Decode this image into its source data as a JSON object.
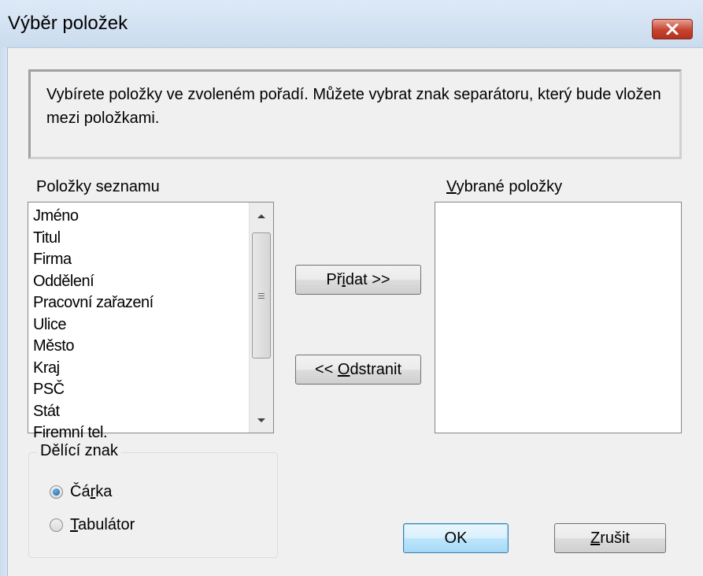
{
  "window": {
    "title": "Výběr položek"
  },
  "info": {
    "text": "Vybírete položky ve zvoleném pořadí. Můžete vybrat znak separátoru, který bude vložen mezi položkami."
  },
  "list": {
    "label": "Položky seznamu",
    "items": [
      "Jméno",
      "Titul",
      "Firma",
      "Oddělení",
      "Pracovní zařazení",
      "Ulice",
      "Město",
      "Kraj",
      "PSČ",
      "Stát",
      "Firemní tel."
    ]
  },
  "selected": {
    "label_first": "V",
    "label_rest": "ybrané položky",
    "items": []
  },
  "buttons": {
    "add_pre": "Př",
    "add_accel": "i",
    "add_post": "dat >>",
    "remove_pre": "<< ",
    "remove_accel": "O",
    "remove_post": "dstranit",
    "ok": "OK",
    "cancel_accel": "Z",
    "cancel_post": "rušit"
  },
  "separator": {
    "legend": "Dělící znak",
    "comma_pre": "Čá",
    "comma_accel": "r",
    "comma_post": "ka",
    "tab_accel": "T",
    "tab_post": "abulátor",
    "selected": "Čárka"
  },
  "colors": {
    "window_bg": "#f0f0f0",
    "titlebar": "#cbdcef",
    "close_button": "#c5432f",
    "default_button_border": "#3c7fb1",
    "radio_fill": "#1b5f9c"
  },
  "icons": {
    "close": "close-icon",
    "scroll_up": "scroll-up-arrow-icon",
    "scroll_down": "scroll-down-arrow-icon",
    "scroll_grip": "scroll-grip-icon"
  }
}
